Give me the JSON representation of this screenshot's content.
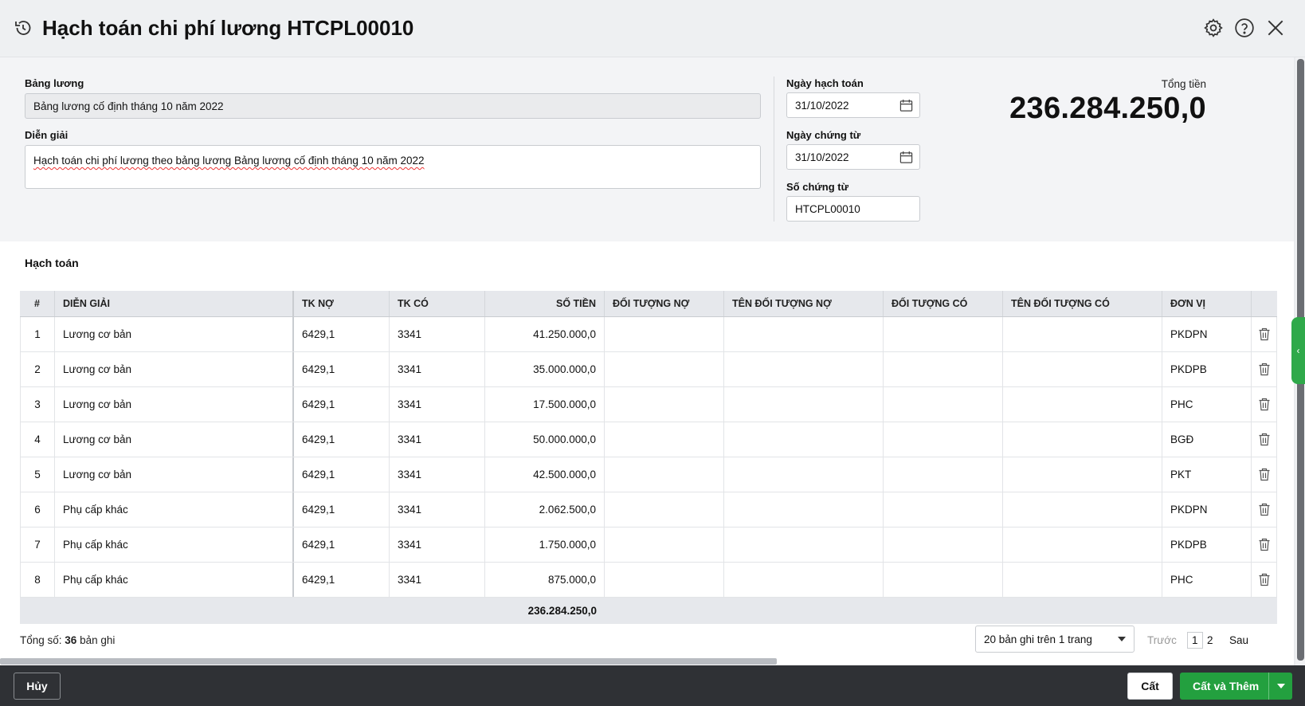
{
  "header": {
    "title": "Hạch toán chi phí lương HTCPL00010"
  },
  "form": {
    "payroll_label": "Bảng lương",
    "payroll_value": "Bảng lương cố định tháng 10 năm 2022",
    "description_label": "Diễn giải",
    "description_value": "Hạch toán chi phí lương theo bảng lương Bảng lương cố định tháng 10 năm 2022",
    "posting_date_label": "Ngày hạch toán",
    "posting_date_value": "31/10/2022",
    "voucher_date_label": "Ngày chứng từ",
    "voucher_date_value": "31/10/2022",
    "voucher_no_label": "Số chứng từ",
    "voucher_no_value": "HTCPL00010",
    "total_label": "Tổng tiền",
    "total_value": "236.284.250,0"
  },
  "section": {
    "title": "Hạch toán"
  },
  "grid": {
    "columns": [
      "#",
      "DIỄN GIẢI",
      "TK NỢ",
      "TK CÓ",
      "SỐ TIỀN",
      "ĐỐI TƯỢNG NỢ",
      "TÊN ĐỐI TƯỢNG NỢ",
      "ĐỐI TƯỢNG CÓ",
      "TÊN ĐỐI TƯỢNG CÓ",
      "ĐƠN VỊ"
    ],
    "rows": [
      {
        "no": "1",
        "desc": "Lương cơ bản",
        "debit": "6429,1",
        "credit": "3341",
        "amount": "41.250.000,0",
        "unit": "PKDPN"
      },
      {
        "no": "2",
        "desc": "Lương cơ bản",
        "debit": "6429,1",
        "credit": "3341",
        "amount": "35.000.000,0",
        "unit": "PKDPB"
      },
      {
        "no": "3",
        "desc": "Lương cơ bản",
        "debit": "6429,1",
        "credit": "3341",
        "amount": "17.500.000,0",
        "unit": "PHC"
      },
      {
        "no": "4",
        "desc": "Lương cơ bản",
        "debit": "6429,1",
        "credit": "3341",
        "amount": "50.000.000,0",
        "unit": "BGĐ"
      },
      {
        "no": "5",
        "desc": "Lương cơ bản",
        "debit": "6429,1",
        "credit": "3341",
        "amount": "42.500.000,0",
        "unit": "PKT"
      },
      {
        "no": "6",
        "desc": "Phụ cấp khác",
        "debit": "6429,1",
        "credit": "3341",
        "amount": "2.062.500,0",
        "unit": "PKDPN"
      },
      {
        "no": "7",
        "desc": "Phụ cấp khác",
        "debit": "6429,1",
        "credit": "3341",
        "amount": "1.750.000,0",
        "unit": "PKDPB"
      },
      {
        "no": "8",
        "desc": "Phụ cấp khác",
        "debit": "6429,1",
        "credit": "3341",
        "amount": "875.000,0",
        "unit": "PHC"
      }
    ],
    "sum_amount": "236.284.250,0"
  },
  "pager": {
    "total_prefix": "Tổng số: ",
    "total_count": "36",
    "total_suffix": " bản ghi",
    "page_size": "20 bản ghi trên 1 trang",
    "prev": "Trước",
    "page1": "1",
    "page2": "2",
    "next": "Sau"
  },
  "actions": {
    "cancel": "Hủy",
    "save": "Cất",
    "save_new": "Cất và Thêm"
  },
  "colors": {
    "primary_green": "#23a03f",
    "bottom_bar": "#2f3135"
  }
}
